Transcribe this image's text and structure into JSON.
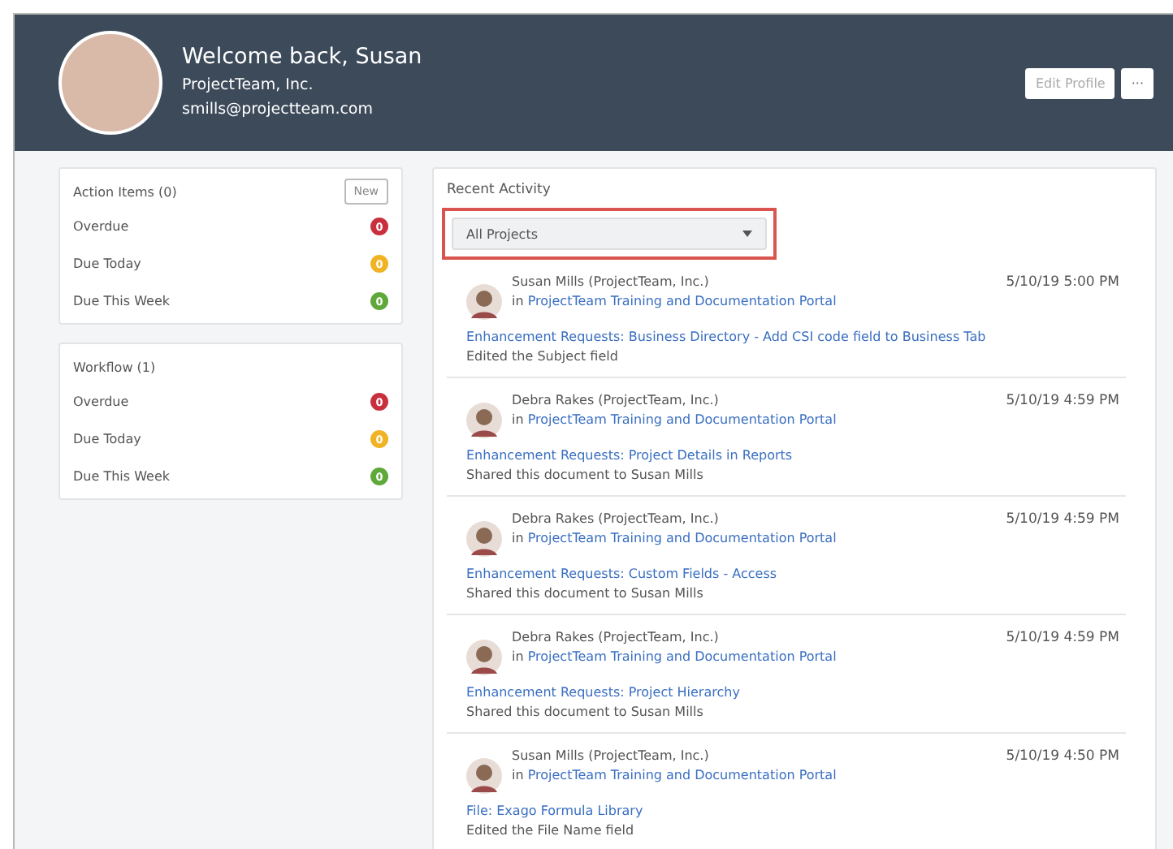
{
  "header": {
    "greeting": "Welcome back, Susan",
    "company": "ProjectTeam, Inc.",
    "email": "smills@projectteam.com",
    "edit_button": "Edit Profile",
    "more_button": "···"
  },
  "panels": [
    {
      "title": "Action Items (0)",
      "new_button": "New",
      "items": [
        {
          "label": "Overdue",
          "count": "0",
          "color": "#c9303e"
        },
        {
          "label": "Due Today",
          "count": "0",
          "color": "#f0b323"
        },
        {
          "label": "Due This Week",
          "count": "0",
          "color": "#5fa83a"
        }
      ]
    },
    {
      "title": "Workflow (1)",
      "items": [
        {
          "label": "Overdue",
          "count": "0",
          "color": "#c9303e"
        },
        {
          "label": "Due Today",
          "count": "0",
          "color": "#f0b323"
        },
        {
          "label": "Due This Week",
          "count": "0",
          "color": "#5fa83a"
        }
      ]
    }
  ],
  "activity": {
    "title": "Recent Activity",
    "filter": {
      "value": "All Projects",
      "highlighted": true
    },
    "items": [
      {
        "user": "Susan Mills (ProjectTeam, Inc.)",
        "prefix": "in",
        "project": "ProjectTeam Training and Documentation Portal",
        "time": "5/10/19 5:00 PM",
        "link": "Enhancement Requests: Business Directory - Add CSI code field to Business Tab",
        "action": "Edited the Subject field"
      },
      {
        "user": "Debra Rakes (ProjectTeam, Inc.)",
        "prefix": "in",
        "project": "ProjectTeam Training and Documentation Portal",
        "time": "5/10/19 4:59 PM",
        "link": "Enhancement Requests: Project Details in Reports",
        "action": "Shared this document to Susan Mills"
      },
      {
        "user": "Debra Rakes (ProjectTeam, Inc.)",
        "prefix": "in",
        "project": "ProjectTeam Training and Documentation Portal",
        "time": "5/10/19 4:59 PM",
        "link": "Enhancement Requests: Custom Fields - Access",
        "action": "Shared this document to Susan Mills"
      },
      {
        "user": "Debra Rakes (ProjectTeam, Inc.)",
        "prefix": "in",
        "project": "ProjectTeam Training and Documentation Portal",
        "time": "5/10/19 4:59 PM",
        "link": "Enhancement Requests: Project Hierarchy",
        "action": "Shared this document to Susan Mills"
      },
      {
        "user": "Susan Mills (ProjectTeam, Inc.)",
        "prefix": "in",
        "project": "ProjectTeam Training and Documentation Portal",
        "time": "5/10/19 4:50 PM",
        "link": "File: Exago Formula Library",
        "action": "Edited the File Name field"
      }
    ]
  }
}
